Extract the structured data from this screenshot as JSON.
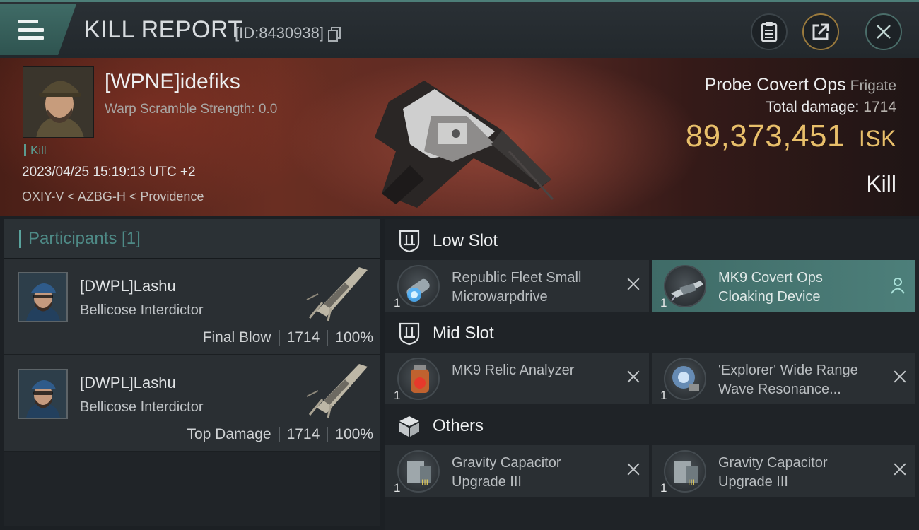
{
  "header": {
    "title": "KILL REPORT",
    "report_id": "[ID:8430938]",
    "buttons": [
      "clipboard-icon",
      "share-icon",
      "close-icon"
    ]
  },
  "victim": {
    "pilot": "[WPNE]idefiks",
    "scramble": "Warp Scramble Strength: 0.0",
    "tag": "Kill",
    "datetime": "2023/04/25 15:19:13 UTC +2",
    "location": "OXIY-V < AZBG-H < Providence",
    "ship": "Probe Covert Ops",
    "ship_class": "Frigate",
    "total_damage_label": "Total damage:",
    "total_damage": "1714",
    "isk_value": "89,373,451",
    "isk_unit": "ISK",
    "result": "Kill"
  },
  "participants": {
    "header": "Participants [1]",
    "rows": [
      {
        "name": "[DWPL]Lashu",
        "ship": "Bellicose Interdictor",
        "role": "Final Blow",
        "damage": "1714",
        "percent": "100%"
      },
      {
        "name": "[DWPL]Lashu",
        "ship": "Bellicose Interdictor",
        "role": "Top Damage",
        "damage": "1714",
        "percent": "100%"
      }
    ]
  },
  "fitting": {
    "low_slot_label": "Low Slot",
    "mid_slot_label": "Mid Slot",
    "others_label": "Others",
    "low": [
      {
        "qty": "1",
        "name": "Republic Fleet Small Microwarpdrive",
        "icon": "microwarpdrive-icon"
      },
      {
        "qty": "1",
        "name": "MK9 Covert Ops Cloaking Device",
        "icon": "cloaking-device-icon"
      }
    ],
    "mid": [
      {
        "qty": "1",
        "name": "MK9 Relic Analyzer",
        "icon": "relic-analyzer-icon"
      },
      {
        "qty": "1",
        "name": "'Explorer' Wide Range Wave Resonance...",
        "icon": "scanner-icon"
      }
    ],
    "others": [
      {
        "qty": "1",
        "name": "Gravity Capacitor Upgrade III",
        "icon": "rig-icon"
      },
      {
        "qty": "1",
        "name": "Gravity Capacitor Upgrade III",
        "icon": "rig-icon"
      }
    ]
  },
  "colors": {
    "accent": "#4d7e78",
    "isk": "#e8bf6a",
    "active_module": "#4d7f7a"
  }
}
